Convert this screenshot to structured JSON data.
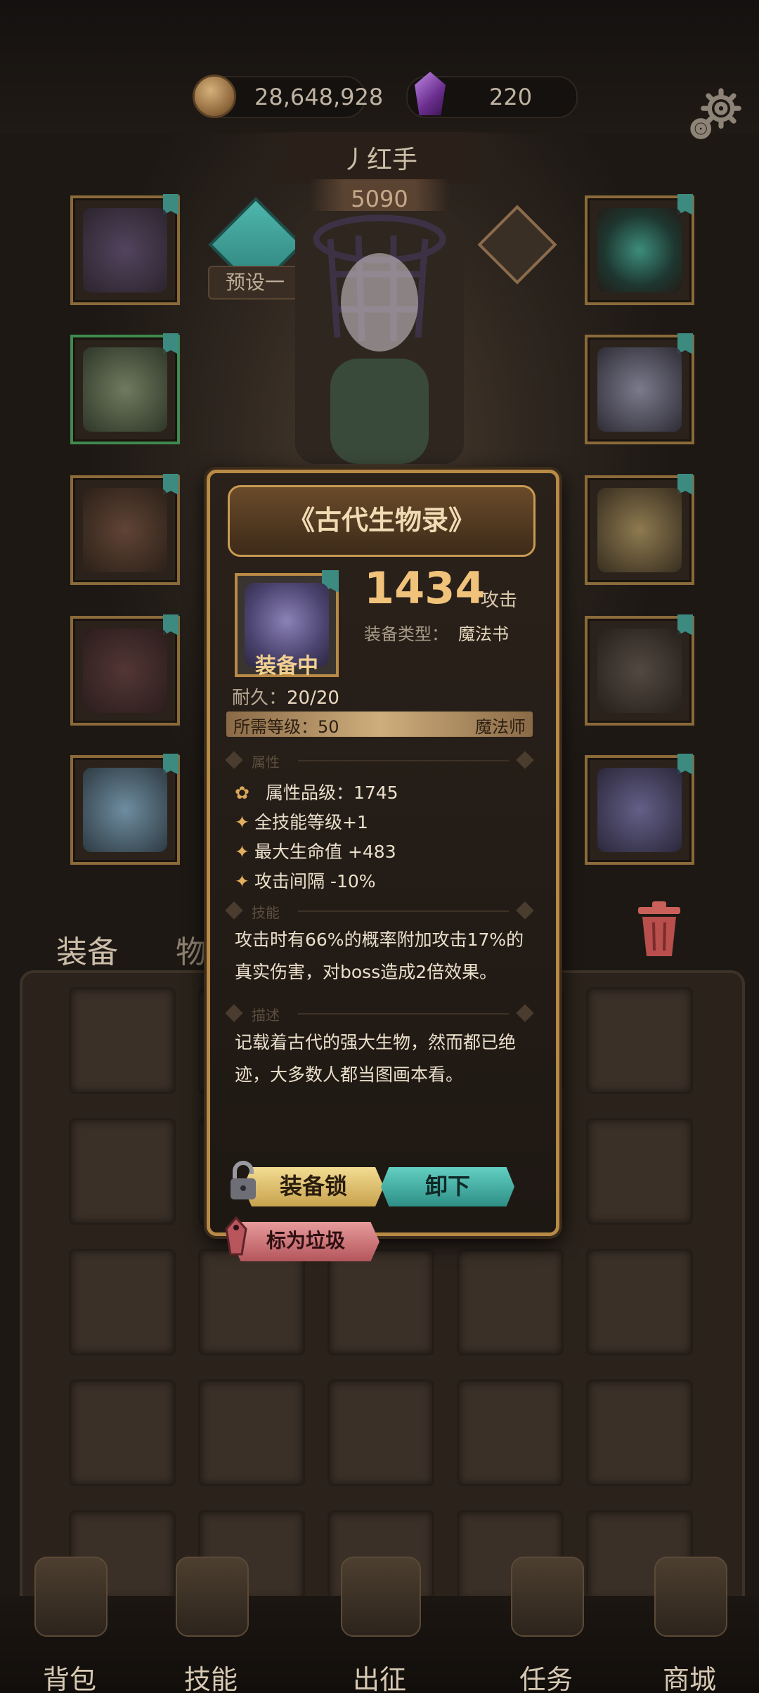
{
  "currency": {
    "coins": "28,648,928",
    "gems": "220"
  },
  "hero": {
    "name": "丿红手",
    "power": "5090",
    "preset": "预设一"
  },
  "tabs": {
    "equipment": "装备",
    "items": "物品"
  },
  "item": {
    "title": "《古代生物录》",
    "attack_value": "1434",
    "attack_unit": "攻击",
    "type_label": "装备类型：",
    "type_value": "魔法书",
    "equipped_badge": "装备中",
    "durability_label": "耐久：",
    "durability_value": "20/20",
    "required_level": "所需等级：50",
    "class": "魔法师",
    "section_attributes": "属性",
    "section_skill": "技能",
    "section_description": "描述",
    "attributes": [
      "属性品级：1745",
      "全技能等级+1",
      "最大生命值 +483",
      "攻击间隔 -10%"
    ],
    "skill_text": "攻击时有66%的概率附加攻击17%的真实伤害，对boss造成2倍效果。",
    "description_text": "记载着古代的强大生物，然而都已绝迹，大多数人都当图画本看。",
    "buttons": {
      "lock": "装备锁",
      "unequip": "卸下",
      "mark_junk": "标为垃圾"
    }
  },
  "nav": [
    "背包",
    "技能",
    "出征",
    "任务",
    "商城"
  ],
  "colors": {
    "gold": "#b88a45",
    "teal": "#3d8a80",
    "attack": "#f0c27a"
  }
}
